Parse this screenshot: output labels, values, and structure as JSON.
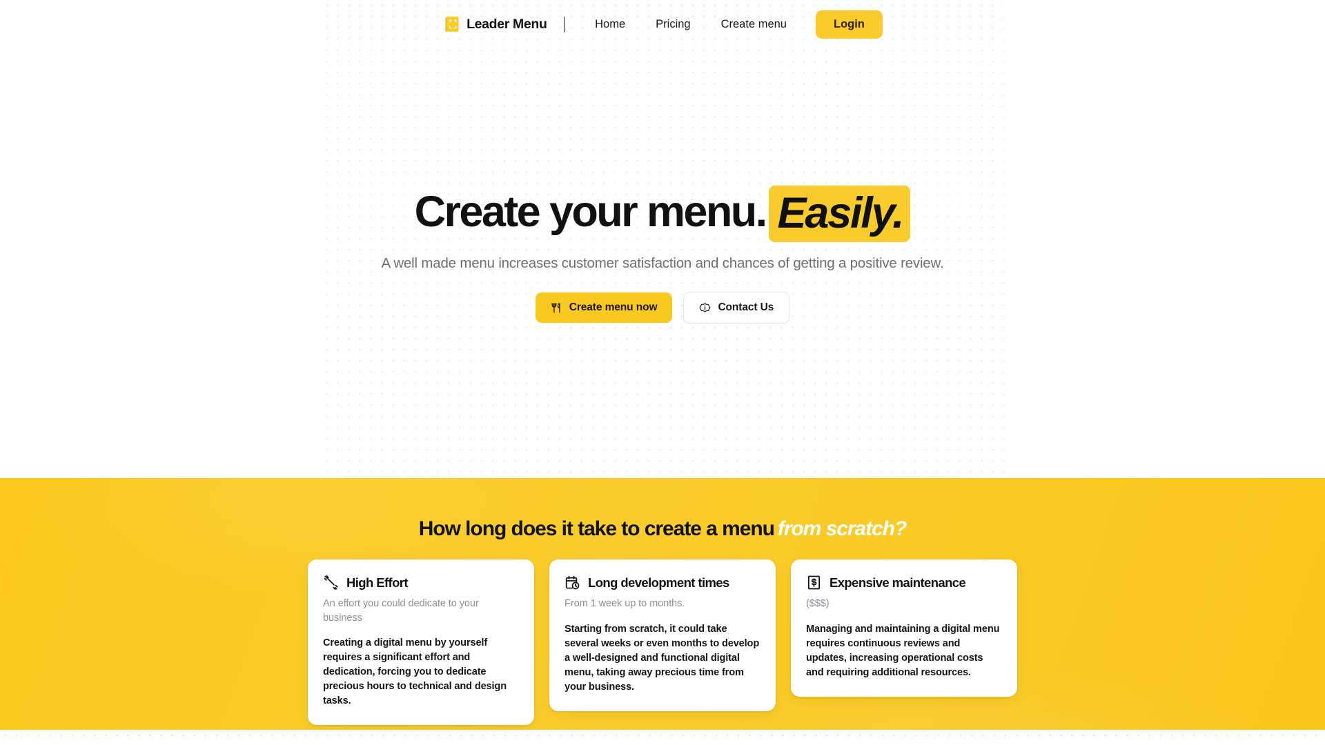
{
  "brand": {
    "name": "Leader Menu",
    "logo_icon": "menu-book-scan-icon",
    "accent_yellow": "#FBCB2B",
    "highlight_yellow": "#FACB2C",
    "section_yellow": "#FBC91F"
  },
  "nav": {
    "links": [
      {
        "label": "Home",
        "name": "nav-link-home"
      },
      {
        "label": "Pricing",
        "name": "nav-link-pricing"
      },
      {
        "label": "Create menu",
        "name": "nav-link-create-menu"
      }
    ],
    "cta": {
      "label": "Login",
      "name": "nav-login-button"
    }
  },
  "hero": {
    "title_main": "Create your menu.",
    "title_highlight": "Easily.",
    "subtitle": "A well made menu increases customer satisfaction and chances of getting a positive review.",
    "primary_button": {
      "label": "Create menu now",
      "icon": "fork-knife-icon"
    },
    "secondary_button": {
      "label": "Contact Us",
      "icon": "info-badge-icon"
    }
  },
  "problem_section": {
    "heading_main": "How long does it take to create a menu",
    "heading_emphasis": "from scratch?",
    "cards": [
      {
        "icon": "dumbbell-icon",
        "title": "High Effort",
        "subtitle": "An effort you could dedicate to your business",
        "body": "Creating a digital menu by yourself requires a significant effort and dedication, forcing you to dedicate precious hours to technical and design tasks."
      },
      {
        "icon": "calendar-clock-icon",
        "title": "Long development times",
        "subtitle": "From 1 week up to months.",
        "body": "Starting from scratch, it could take several weeks or even months to develop a well-designed and functional digital menu, taking away precious time from your business."
      },
      {
        "icon": "banknote-dollar-icon",
        "title": "Expensive maintenance",
        "subtitle": "($$$)",
        "body": "Managing and maintaining a digital menu requires continuous reviews and updates, increasing operational costs and requiring additional resources."
      }
    ]
  }
}
